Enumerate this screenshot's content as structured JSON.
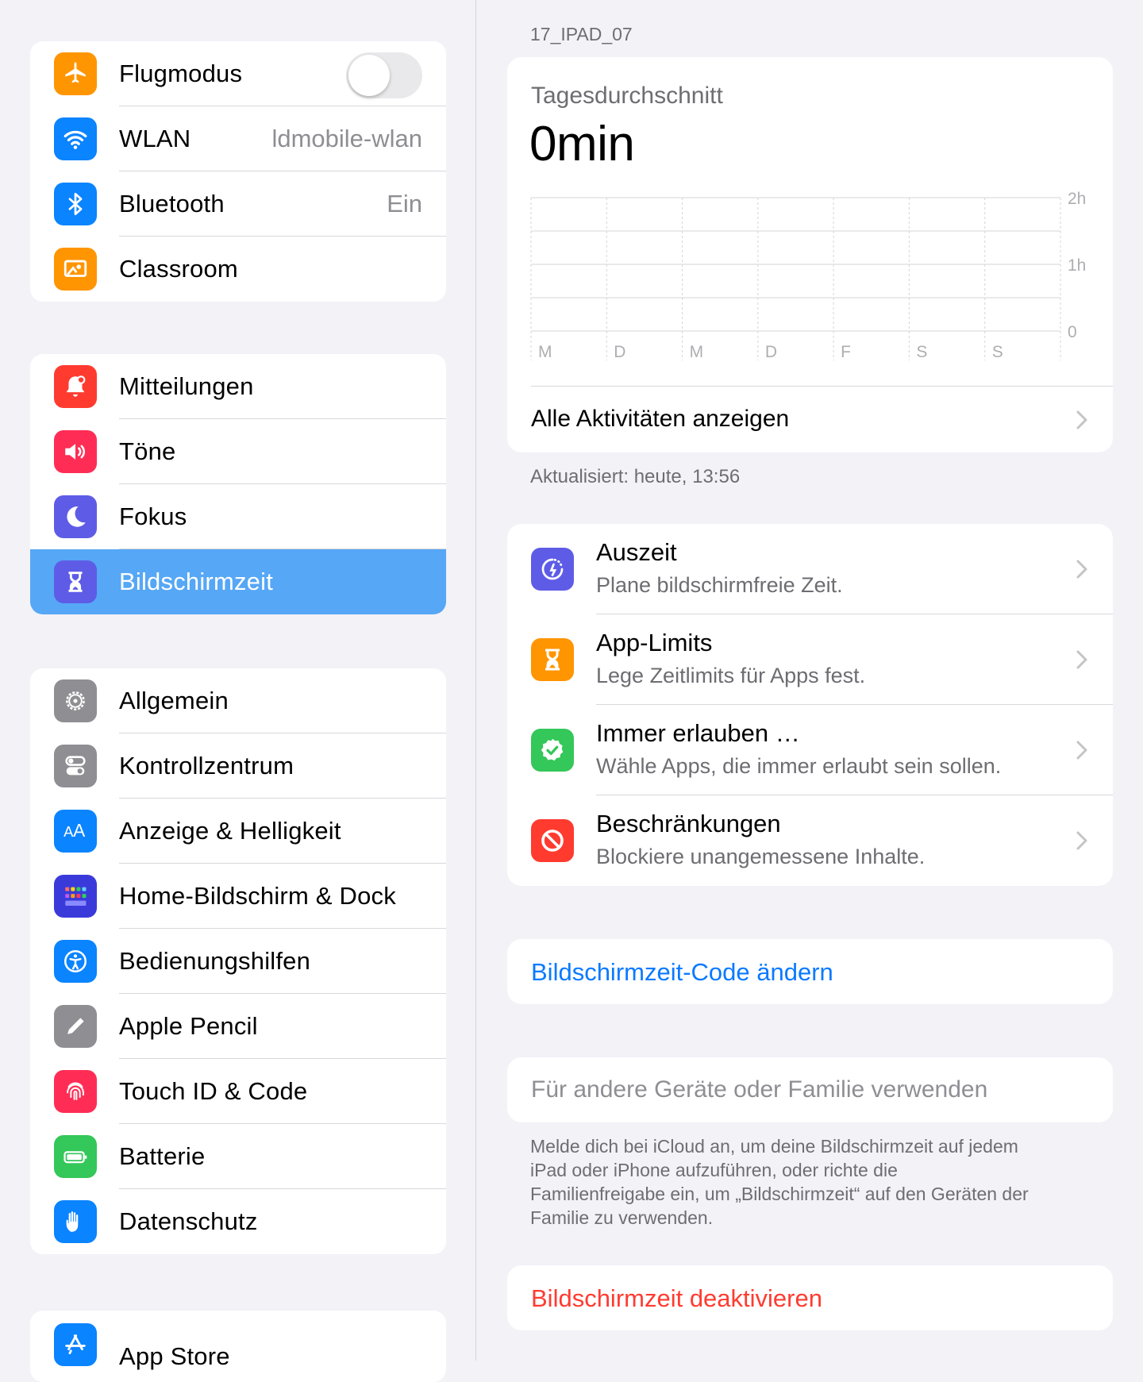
{
  "sidebar": {
    "group1": [
      {
        "label": "Flugmodus",
        "value": "",
        "icon": "airplane-icon",
        "color": "#ff9500",
        "toggle": false
      },
      {
        "label": "WLAN",
        "value": "ldmobile-wlan",
        "icon": "wifi-icon",
        "color": "#0a84ff"
      },
      {
        "label": "Bluetooth",
        "value": "Ein",
        "icon": "bluetooth-icon",
        "color": "#0a84ff"
      },
      {
        "label": "Classroom",
        "value": "",
        "icon": "classroom-icon",
        "color": "#ff9500"
      }
    ],
    "group2": [
      {
        "label": "Mitteilungen",
        "icon": "notifications-icon",
        "color": "#ff3b30"
      },
      {
        "label": "Töne",
        "icon": "speaker-icon",
        "color": "#ff2d55"
      },
      {
        "label": "Fokus",
        "icon": "moon-icon",
        "color": "#5e5ce6"
      },
      {
        "label": "Bildschirmzeit",
        "icon": "hourglass-icon",
        "color": "#5e5ce6",
        "selected": true
      }
    ],
    "group3": [
      {
        "label": "Allgemein",
        "icon": "gear-icon",
        "color": "#8e8e93"
      },
      {
        "label": "Kontrollzentrum",
        "icon": "switches-icon",
        "color": "#8e8e93"
      },
      {
        "label": "Anzeige & Helligkeit",
        "icon": "text-size-icon",
        "color": "#0a84ff"
      },
      {
        "label": "Home-Bildschirm & Dock",
        "icon": "grid-icon",
        "color": "#3a3adb"
      },
      {
        "label": "Bedienungshilfen",
        "icon": "accessibility-icon",
        "color": "#0a84ff"
      },
      {
        "label": "Apple Pencil",
        "icon": "pencil-icon",
        "color": "#8e8e93"
      },
      {
        "label": "Touch ID & Code",
        "icon": "fingerprint-icon",
        "color": "#ff2d55"
      },
      {
        "label": "Batterie",
        "icon": "battery-icon",
        "color": "#34c759"
      },
      {
        "label": "Datenschutz",
        "icon": "hand-icon",
        "color": "#0a84ff"
      }
    ],
    "group4": [
      {
        "label": "App Store",
        "icon": "appstore-icon",
        "color": "#0a84ff"
      }
    ]
  },
  "detail": {
    "device_name": "17_IPAD_07",
    "daily_average_label": "Tagesdurchschnitt",
    "daily_average_value": "0min",
    "all_activity_label": "Alle Aktivitäten anzeigen",
    "updated_text": "Aktualisiert: heute, 13:56",
    "features": [
      {
        "title": "Auszeit",
        "subtitle": "Plane bildschirmfreie Zeit.",
        "icon": "downtime-icon",
        "color": "#5e5ce6"
      },
      {
        "title": "App-Limits",
        "subtitle": "Lege Zeitlimits für Apps fest.",
        "icon": "hourglass-icon",
        "color": "#ff9500"
      },
      {
        "title": "Immer erlauben …",
        "subtitle": "Wähle Apps, die immer erlaubt sein sollen.",
        "icon": "checkmark-badge-icon",
        "color": "#34c759"
      },
      {
        "title": "Beschränkungen",
        "subtitle": "Blockiere unangemessene Inhalte.",
        "icon": "restriction-icon",
        "color": "#ff3b30"
      }
    ],
    "change_code_label": "Bildschirmzeit-Code ändern",
    "family_label": "Für andere Geräte oder Familie verwenden",
    "family_footer": [
      "Melde dich bei iCloud an, um deine Bildschirmzeit auf jedem",
      "iPad oder iPhone aufzuführen, oder richte die",
      "Familienfreigabe ein, um „Bildschirmzeit“ auf den Geräten der",
      "Familie zu verwenden."
    ],
    "deactivate_label": "Bildschirmzeit deaktivieren",
    "link_color": "#0a7aff",
    "destructive_color": "#ff3b30"
  },
  "chart_data": {
    "type": "bar",
    "categories": [
      "M",
      "D",
      "M",
      "D",
      "F",
      "S",
      "S"
    ],
    "values": [
      0,
      0,
      0,
      0,
      0,
      0,
      0
    ],
    "y_ticks": [
      "2h",
      "1h",
      "0"
    ],
    "ylim": [
      0,
      2
    ],
    "grid": true
  }
}
